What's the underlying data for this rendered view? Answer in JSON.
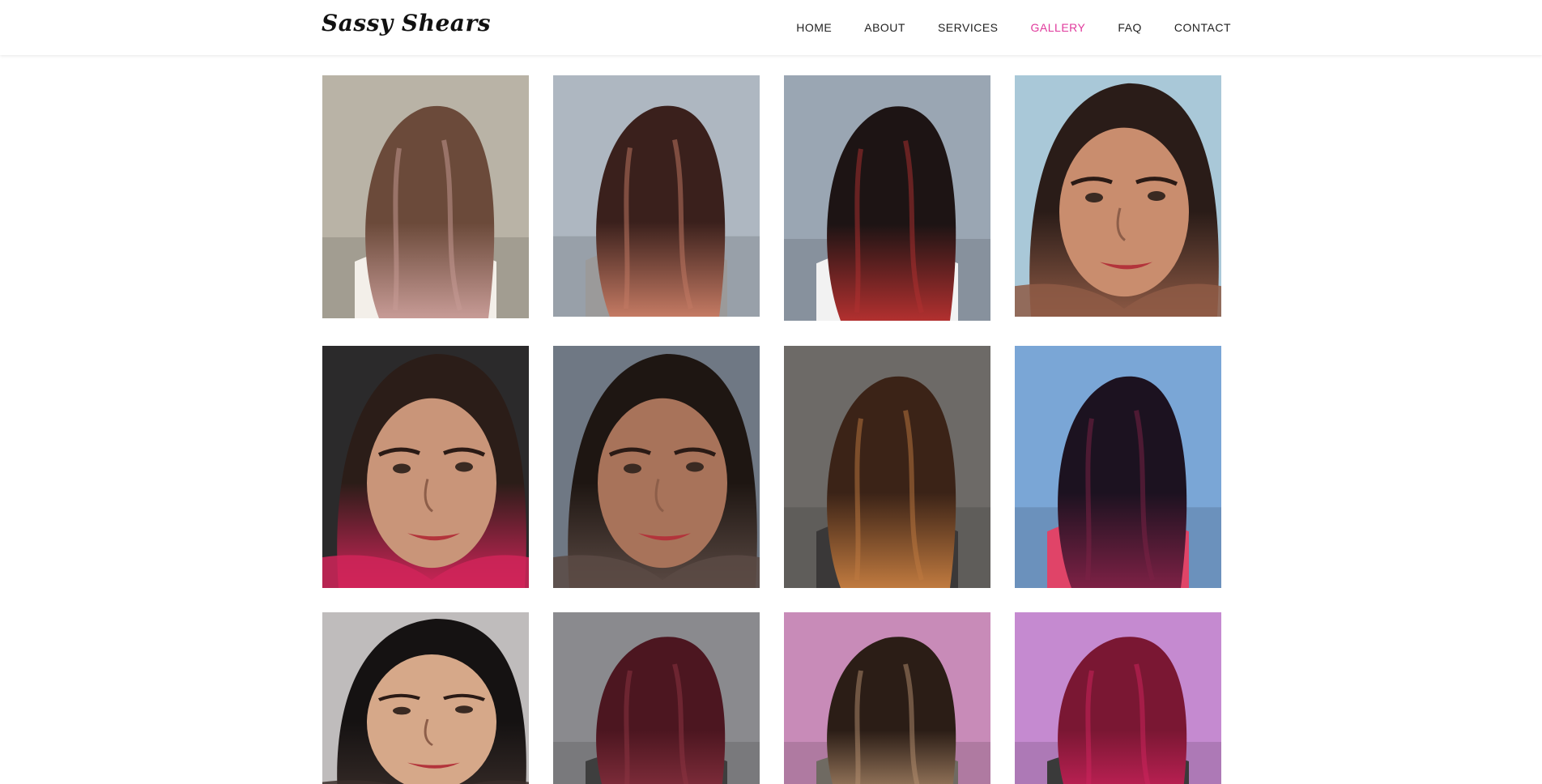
{
  "header": {
    "logo": "Sassy Shears",
    "nav": [
      {
        "label": "HOME",
        "active": false
      },
      {
        "label": "ABOUT",
        "active": false
      },
      {
        "label": "SERVICES",
        "active": false
      },
      {
        "label": "GALLERY",
        "active": true
      },
      {
        "label": "FAQ",
        "active": false
      },
      {
        "label": "CONTACT",
        "active": false
      }
    ]
  },
  "colors": {
    "accent": "#e0399c",
    "nav_text": "#222222",
    "background": "#ffffff"
  },
  "gallery": {
    "photos": [
      {
        "subject": "long balayage waves, rose-gold ends",
        "bg": "#b9b3a6",
        "hair": "#6b4a3a",
        "hair2": "#c79b96",
        "skin": "#f3efe9",
        "type": "back"
      },
      {
        "subject": "short wavy bob, copper-pink highlights",
        "bg": "#aeb7c1",
        "hair": "#3a201c",
        "hair2": "#c47a63",
        "skin": "#9b9a9a",
        "type": "back"
      },
      {
        "subject": "long dark hair with red ombre ends",
        "bg": "#9aa6b3",
        "hair": "#1d1414",
        "hair2": "#b2302f",
        "skin": "#f2f2f2",
        "type": "back"
      },
      {
        "subject": "close-up face with red lipstick",
        "bg": "#a9c8d8",
        "hair": "#2a1c18",
        "hair2": "#8e5a45",
        "skin": "#c98d6e",
        "type": "face"
      },
      {
        "subject": "face selfie, shaped eyebrows",
        "bg": "#2b2a2b",
        "hair": "#2b1d18",
        "hair2": "#d02559",
        "skin": "#c99579",
        "type": "face"
      },
      {
        "subject": "smiling woman with straight dark hair",
        "bg": "#6f7884",
        "hair": "#1e1612",
        "hair2": "#5b4a44",
        "skin": "#a8735a",
        "type": "face"
      },
      {
        "subject": "layered curls with caramel highlights",
        "bg": "#6d6a67",
        "hair": "#3b2317",
        "hair2": "#c07a3f",
        "skin": "#3a3838",
        "type": "back"
      },
      {
        "subject": "dark curls with burgundy tips outdoors",
        "bg": "#7aa6d6",
        "hair": "#1c1220",
        "hair2": "#7d2145",
        "skin": "#e04468",
        "type": "back"
      },
      {
        "subject": "portrait with slicked black hair",
        "bg": "#bfbcbc",
        "hair": "#151212",
        "hair2": "#3a2e2a",
        "skin": "#d6a889",
        "type": "face"
      },
      {
        "subject": "burgundy curly updo",
        "bg": "#8a8a8e",
        "hair": "#4c1620",
        "hair2": "#8e3342",
        "skin": "#3e3e3e",
        "type": "back"
      },
      {
        "subject": "brunette balayage in salon",
        "bg": "#c88bb8",
        "hair": "#2b1d16",
        "hair2": "#b5906f",
        "skin": "#6f6a62",
        "type": "back"
      },
      {
        "subject": "straight magenta-red hair",
        "bg": "#c58ad0",
        "hair": "#7a1733",
        "hair2": "#d0235d",
        "skin": "#3a3a3a",
        "type": "back"
      }
    ]
  }
}
